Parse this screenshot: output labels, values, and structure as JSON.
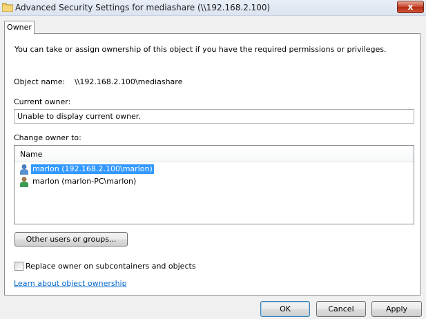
{
  "window": {
    "title": "Advanced Security Settings for mediashare (\\\\192.168.2.100)",
    "close_label": "x"
  },
  "tabs": [
    {
      "label": "Owner",
      "selected": true
    }
  ],
  "owner_tab": {
    "description": "You can take or assign ownership of this object if you have the required permissions or privileges.",
    "object_name_label": "Object name:",
    "object_name_value": "\\\\192.168.2.100\\mediashare",
    "current_owner_label": "Current owner:",
    "current_owner_value": "Unable to display current owner.",
    "change_owner_label": "Change owner to:",
    "list_header": "Name",
    "owners": [
      {
        "label": "marlon (192.168.2.100\\marlon)",
        "icon": "user-icon",
        "selected": true
      },
      {
        "label": "marlon (marlon-PC\\marlon)",
        "icon": "user-icon",
        "selected": false
      }
    ],
    "other_users_button": "Other users or groups...",
    "replace_owner_checkbox": {
      "label": "Replace owner on subcontainers and objects",
      "checked": false
    },
    "learn_link": "Learn about object ownership"
  },
  "footer": {
    "ok_label": "OK",
    "cancel_label": "Cancel",
    "apply_label": "Apply"
  },
  "colors": {
    "selection": "#3399ff",
    "link": "#0066cc",
    "close_button": "#c7442b"
  }
}
